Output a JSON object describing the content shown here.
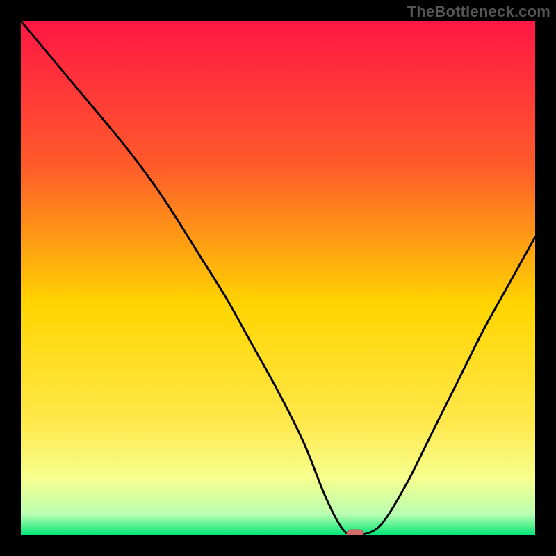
{
  "watermark": "TheBottleneck.com",
  "colors": {
    "bg": "#000000",
    "watermark": "#555555",
    "curve": "#000000",
    "marker_fill": "#d46a6a",
    "marker_stroke": "#b84d4d",
    "gradient_top": "#ff1744",
    "gradient_mid_upper": "#ff6a00",
    "gradient_mid": "#ffd400",
    "gradient_lower": "#f6ff8f",
    "gradient_bottom": "#00e676"
  },
  "chart_data": {
    "type": "line",
    "title": "",
    "xlabel": "",
    "ylabel": "",
    "xlim": [
      0,
      100
    ],
    "ylim": [
      0,
      100
    ],
    "x": [
      0,
      10,
      20,
      26,
      30,
      35,
      40,
      45,
      50,
      55,
      59,
      62,
      64,
      66,
      70,
      75,
      80,
      85,
      90,
      95,
      100
    ],
    "values": [
      100,
      88,
      76,
      68,
      62,
      54,
      46,
      37,
      28,
      18,
      8,
      2,
      0,
      0,
      2,
      10,
      20,
      30,
      40,
      49,
      58
    ],
    "marker": {
      "x": 65,
      "y": 0
    }
  }
}
